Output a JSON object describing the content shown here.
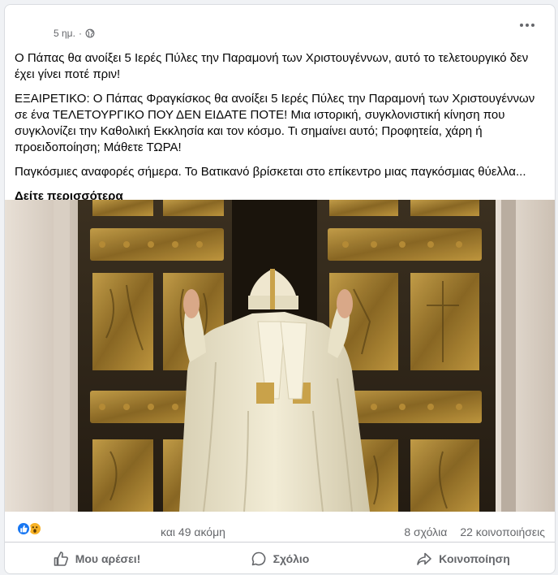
{
  "post": {
    "time": "5 ημ.",
    "separator": "·",
    "text_line1": "Ο Πάπας θα ανοίξει 5 Ιερές Πύλες την Παραμονή των Χριστουγέννων, αυτό το τελετουργικό δεν έχει γίνει ποτέ πριν!",
    "text_line2": "ΕΞΑΙΡΕΤΙΚΟ: Ο Πάπας Φραγκίσκος θα ανοίξει 5 Ιερές Πύλες την Παραμονή των Χριστουγέννων σε ένα ΤΕΛΕΤΟΥΡΓΙΚΟ ΠΟΥ ΔΕΝ ΕΙΔΑΤΕ ΠΟΤΕ! Μια ιστορική, συγκλονιστική κίνηση που συγκλονίζει την Καθολική Εκκλησία και τον κόσμο. Τι σημαίνει αυτό; Προφητεία, χάρη ή προειδοποίηση; Μάθετε ΤΩΡΑ!",
    "text_line3": "Παγκόσμιες αναφορές σήμερα. Το Βατικανό βρίσκεται στο επίκεντρο μιας παγκόσμιας θύελλα...",
    "see_more": "Δείτε περισσότερα"
  },
  "stats": {
    "reactions_others": "και 49 ακόμη",
    "comments": "8 σχόλια",
    "shares": "22 κοινοποιήσεις"
  },
  "actions": {
    "like": "Μου αρέσει!",
    "comment": "Σχόλιο",
    "share": "Κοινοποίηση"
  },
  "icons": {
    "globe": "globe-icon",
    "more": "more-options-icon",
    "like_reaction": "like-reaction-icon",
    "wow_reaction": "wow-reaction-icon",
    "like": "thumbs-up-icon",
    "comment": "comment-icon",
    "share": "share-icon"
  },
  "colors": {
    "secondary_text": "#65676b",
    "like_blue": "#1877f2",
    "wow_yellow": "#f7b125",
    "divider": "#ced0d4"
  }
}
